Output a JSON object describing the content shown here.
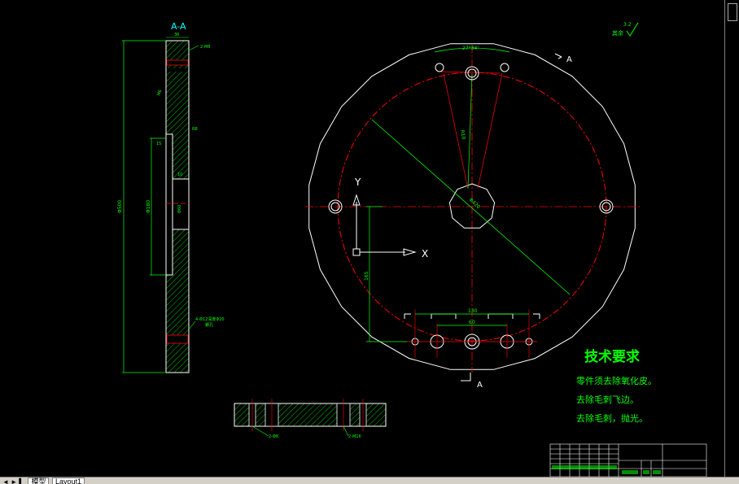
{
  "drawing": {
    "section_label": "A-A",
    "section_dim_top": "36",
    "section_note_top": "2-M8",
    "section_dim_height": "Φ500",
    "section_dim_slot": "Φ180",
    "section_note_angle": "M6",
    "section_dim_r": "R8",
    "section_dim_small1": "15",
    "section_dim_small2": "10",
    "section_dim_center": "Φ60",
    "section_note_bottom1": "4-Φ12深度Φ20",
    "section_note_bottom2": "螺孔",
    "arrow_label_top": "A",
    "arrow_label_bottom": "A",
    "dim_angle": "27°34'",
    "dim_radius": "R10",
    "dim_diag": "Φ420",
    "dim_vertical": "165",
    "dim_130": "130",
    "dim_60": "60",
    "ucs_y": "Y",
    "ucs_x": "X",
    "roughness": "其余",
    "roughness_val": "3.2",
    "bottom_note_left": "2-Φ8",
    "bottom_note_right": "2-M16",
    "tech_title": "技术要求",
    "tech_lines": [
      "零件须去除氧化皮。",
      "去除毛刺飞边。",
      "去除毛刺，抛光。"
    ]
  },
  "colors": {
    "white": "#ffffff",
    "red": "#ff0000",
    "green": "#00ff00",
    "cyan": "#00ffff",
    "yellow": "#ffff00"
  },
  "tabbar": {
    "nav": "◄ ► ▌",
    "tabs": [
      "模型",
      "Layout1"
    ]
  }
}
